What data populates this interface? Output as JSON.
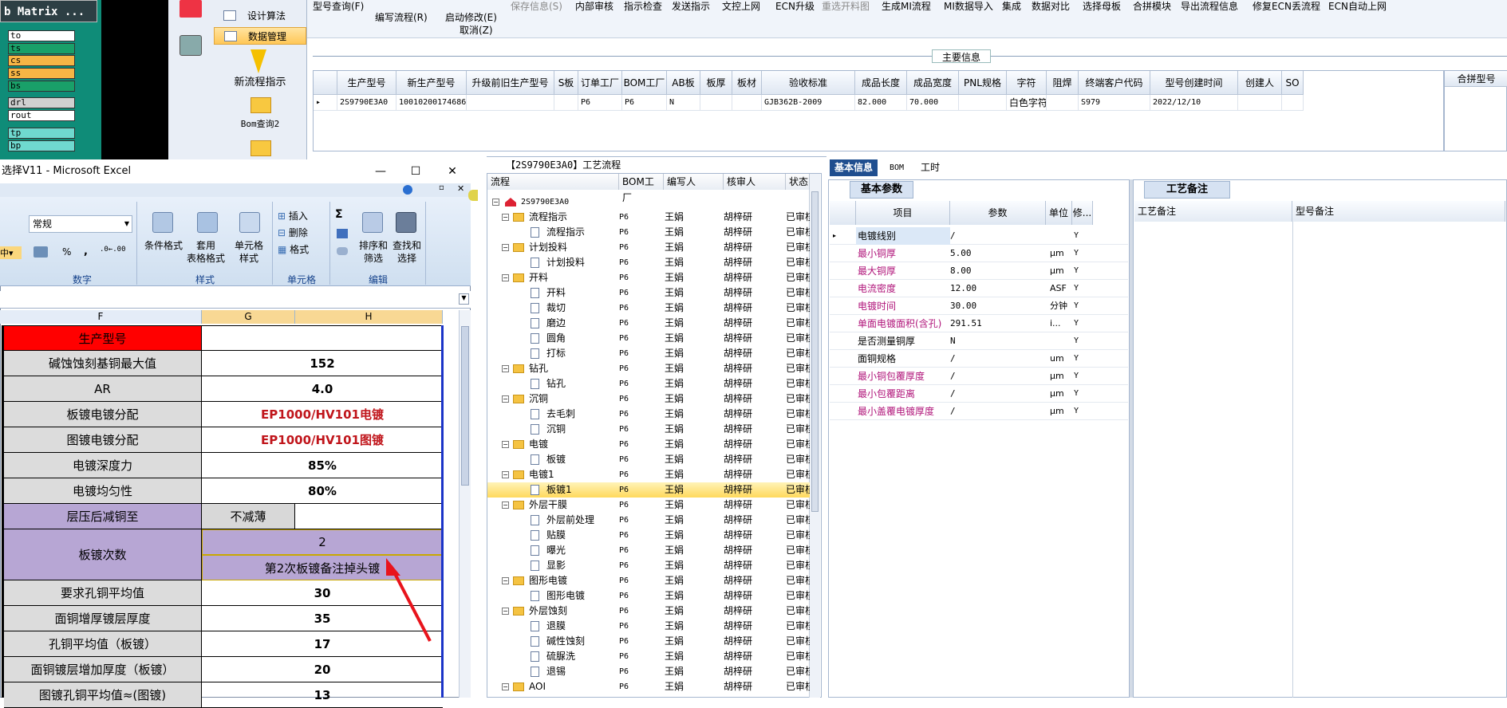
{
  "matrix": {
    "title": "b Matrix ...",
    "rows": [
      {
        "label": "to",
        "color": "#ffffff"
      },
      {
        "label": "ts",
        "color": "#19a069"
      },
      {
        "label": "cs",
        "color": "#f6b545"
      },
      {
        "label": "ss",
        "color": "#f6b545"
      },
      {
        "label": "bs",
        "color": "#19a069"
      },
      {
        "label": "drl",
        "color": "#d0d0d0"
      },
      {
        "label": "rout",
        "color": "#ffffff"
      },
      {
        "label": "tp",
        "color": "#6fd9cf"
      },
      {
        "label": "bp",
        "color": "#6fd9cf"
      }
    ]
  },
  "nav": {
    "items": [
      "设计算法",
      "数据管理"
    ],
    "icons": [
      {
        "label": "新流程指示"
      },
      {
        "label": "Bom查询2"
      }
    ]
  },
  "toolbar": {
    "buttons": [
      "型号查询(F)",
      "编写流程(R)",
      "启动修改(E)",
      "取消(Z)",
      "保存信息(S)",
      "内部审核",
      "指示检查",
      "发送指示",
      "文控上网",
      "ECN升级",
      "重选开料图",
      "生成MI流程",
      "MI数据导入",
      "集成",
      "数据对比",
      "选择母板",
      "合拼模块",
      "导出流程信息",
      "修复ECN丢流程",
      "ECN自动上网"
    ]
  },
  "main_info": {
    "header": "主要信息",
    "columns": [
      "生产型号",
      "新生产型号",
      "升级前旧生产型号",
      "S板",
      "订单工厂",
      "BOM工厂",
      "AB板",
      "板厚",
      "板材",
      "验收标准",
      "成品长度",
      "成品宽度",
      "PNL规格",
      "字符",
      "阻焊",
      "终端客户代码",
      "型号创建时间",
      "创建人",
      "SO"
    ],
    "row": [
      "2S9790E3A0",
      "10010200174686",
      "",
      "",
      "P6",
      "P6",
      "N",
      "",
      "",
      "GJB362B-2009",
      "82.000",
      "70.000",
      "",
      "白色字符",
      "",
      "S979",
      "2022/12/10",
      "",
      ""
    ],
    "combo_label": "合拼型号"
  },
  "excel": {
    "title": "选择V11 - Microsoft Excel",
    "ribbon": {
      "number_format": "常规",
      "groups": [
        "数字",
        "样式",
        "单元格",
        "编辑"
      ],
      "style_items": [
        "条件格式",
        "套用\n表格格式",
        "单元格\n样式"
      ],
      "cell_items": [
        "插入",
        "删除",
        "格式"
      ],
      "edit_items": [
        "排序和\n筛选",
        "查找和\n选择"
      ],
      "symbols": [
        "Σ",
        "%",
        ","
      ]
    },
    "columns": [
      "F",
      "G",
      "H"
    ],
    "rows": [
      {
        "field": "生产型号",
        "value": "",
        "field_bg": "#ff0000"
      },
      {
        "field": "碱蚀蚀刻基铜最大值",
        "value": "152"
      },
      {
        "field": "AR",
        "value": "4.0"
      },
      {
        "field": "板镀电镀分配",
        "value": "EP1000/HV101电镀",
        "red": true
      },
      {
        "field": "图镀电镀分配",
        "value": "EP1000/HV101图镀",
        "red": true
      },
      {
        "field": "电镀深度力",
        "value": "85%"
      },
      {
        "field": "电镀均匀性",
        "value": "80%"
      },
      {
        "field": "层压后减铜至",
        "value": "不减薄",
        "purple": true
      },
      {
        "field": "板镀次数",
        "value": "2",
        "note": "第2次板镀备注掉头镀",
        "purple": true
      },
      {
        "field": "要求孔铜平均值",
        "value": "30"
      },
      {
        "field": "面铜增厚镀层厚度",
        "value": "35"
      },
      {
        "field": "孔铜平均值（板镀）",
        "value": "17"
      },
      {
        "field": "面铜镀层增加厚度（板镀）",
        "value": "20"
      },
      {
        "field": "图镀孔铜平均值≈(图镀)",
        "value": "13"
      }
    ]
  },
  "tree": {
    "title": "【2S9790E3A0】工艺流程",
    "columns": [
      "流程",
      "BOM工厂",
      "编写人",
      "核审人",
      "状态"
    ],
    "root": "2S9790E3A0",
    "rows": [
      {
        "name": "流程指示",
        "level": 1,
        "type": "folder"
      },
      {
        "name": "流程指示",
        "level": 2,
        "type": "doc"
      },
      {
        "name": "计划投料",
        "level": 1,
        "type": "folder"
      },
      {
        "name": "计划投料",
        "level": 2,
        "type": "doc"
      },
      {
        "name": "开料",
        "level": 1,
        "type": "folder"
      },
      {
        "name": "开料",
        "level": 2,
        "type": "doc"
      },
      {
        "name": "裁切",
        "level": 2,
        "type": "doc"
      },
      {
        "name": "磨边",
        "level": 2,
        "type": "doc"
      },
      {
        "name": "圆角",
        "level": 2,
        "type": "doc"
      },
      {
        "name": "打标",
        "level": 2,
        "type": "doc"
      },
      {
        "name": "钻孔",
        "level": 1,
        "type": "folder"
      },
      {
        "name": "钻孔",
        "level": 2,
        "type": "doc"
      },
      {
        "name": "沉铜",
        "level": 1,
        "type": "folder"
      },
      {
        "name": "去毛刺",
        "level": 2,
        "type": "doc"
      },
      {
        "name": "沉铜",
        "level": 2,
        "type": "doc"
      },
      {
        "name": "电镀",
        "level": 1,
        "type": "folder"
      },
      {
        "name": "板镀",
        "level": 2,
        "type": "doc"
      },
      {
        "name": "电镀1",
        "level": 1,
        "type": "folder"
      },
      {
        "name": "板镀1",
        "level": 2,
        "type": "doc",
        "selected": true
      },
      {
        "name": "外层干膜",
        "level": 1,
        "type": "folder"
      },
      {
        "name": "外层前处理",
        "level": 2,
        "type": "doc"
      },
      {
        "name": "贴膜",
        "level": 2,
        "type": "doc"
      },
      {
        "name": "曝光",
        "level": 2,
        "type": "doc"
      },
      {
        "name": "显影",
        "level": 2,
        "type": "doc"
      },
      {
        "name": "图形电镀",
        "level": 1,
        "type": "folder"
      },
      {
        "name": "图形电镀",
        "level": 2,
        "type": "doc"
      },
      {
        "name": "外层蚀刻",
        "level": 1,
        "type": "folder"
      },
      {
        "name": "退膜",
        "level": 2,
        "type": "doc"
      },
      {
        "name": "碱性蚀刻",
        "level": 2,
        "type": "doc"
      },
      {
        "name": "硫脲洗",
        "level": 2,
        "type": "doc"
      },
      {
        "name": "退锡",
        "level": 2,
        "type": "doc"
      },
      {
        "name": "AOI",
        "level": 1,
        "type": "folder"
      }
    ],
    "bom": "P6",
    "writer": "王娟",
    "reviewer": "胡梓研",
    "status": "已审核"
  },
  "tabs": [
    "基本信息",
    "BOM",
    "工时"
  ],
  "params": {
    "tab_label": "基本参数",
    "columns": [
      "项目",
      "参数",
      "单位",
      "修..."
    ],
    "rows": [
      {
        "name": "电镀线别",
        "value": "/",
        "unit": "",
        "mod": "Y",
        "highlight": true
      },
      {
        "name": "最小铜厚",
        "value": "5.00",
        "unit": "μm",
        "mod": "Y",
        "pink": true
      },
      {
        "name": "最大铜厚",
        "value": "8.00",
        "unit": "μm",
        "mod": "Y",
        "pink": true
      },
      {
        "name": "电流密度",
        "value": "12.00",
        "unit": "ASF",
        "mod": "Y",
        "pink": true
      },
      {
        "name": "电镀时间",
        "value": "30.00",
        "unit": "分钟",
        "mod": "Y",
        "pink": true
      },
      {
        "name": "单面电镀面积(含孔)",
        "value": "291.51",
        "unit": "i...",
        "mod": "Y",
        "pink": true
      },
      {
        "name": "是否测量铜厚",
        "value": "N",
        "unit": "",
        "mod": "Y"
      },
      {
        "name": "面铜规格",
        "value": "/",
        "unit": "um",
        "mod": "Y"
      },
      {
        "name": "最小铜包覆厚度",
        "value": "/",
        "unit": "μm",
        "mod": "Y",
        "pink": true
      },
      {
        "name": "最小包覆距离",
        "value": "/",
        "unit": "μm",
        "mod": "Y",
        "pink": true
      },
      {
        "name": "最小盖覆电镀厚度",
        "value": "/",
        "unit": "μm",
        "mod": "Y",
        "pink": true
      }
    ]
  },
  "process": {
    "tab_label": "工艺备注",
    "columns": [
      "工艺备注",
      "型号备注"
    ]
  }
}
